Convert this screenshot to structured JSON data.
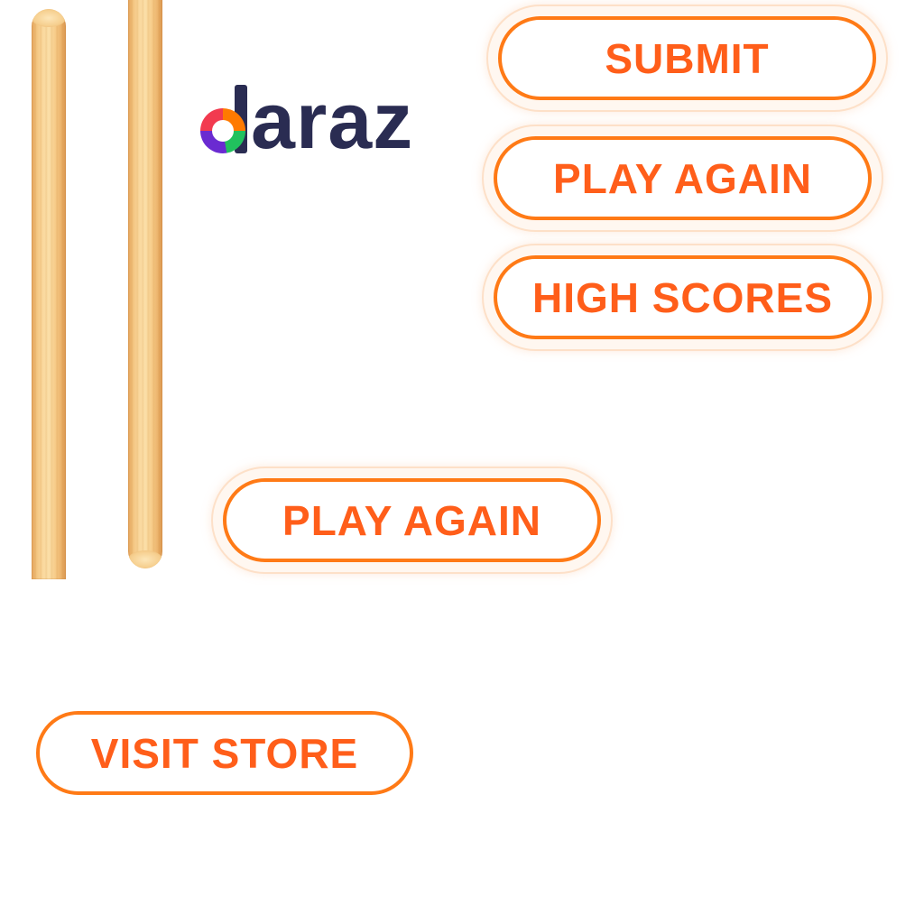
{
  "logo": {
    "text": "araz",
    "full_text": "daraz"
  },
  "buttons": {
    "submit_label": "SUBMIT",
    "play_again_label": "PLAY AGAIN",
    "high_scores_label": "HIGH SCORES",
    "play_again_center_label": "PLAY AGAIN",
    "visit_store_label": "VISIT STORE"
  },
  "colors": {
    "accent_orange": "#ff5e1a",
    "border_orange": "#ff7a16",
    "logo_navy": "#2a2c52",
    "wood_light": "#fbdfa8",
    "wood_dark": "#d9954e"
  }
}
